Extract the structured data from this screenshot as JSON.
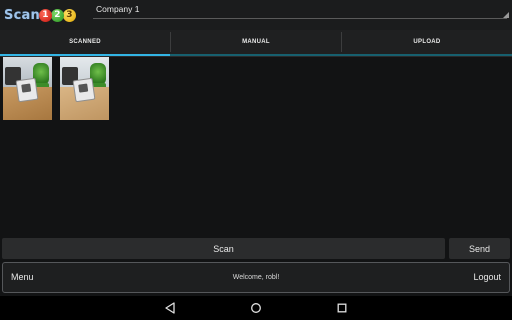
{
  "app": {
    "logo_text": "Scan",
    "logo_digits": [
      "1",
      "2",
      "3"
    ]
  },
  "company_select": {
    "value": "Company 1"
  },
  "tabs": [
    {
      "label": "SCANNED",
      "selected": true
    },
    {
      "label": "MANUAL",
      "selected": false
    },
    {
      "label": "UPLOAD",
      "selected": false
    }
  ],
  "thumbnails": [
    {
      "kind": "scanned-photo"
    },
    {
      "kind": "scanned-photo"
    }
  ],
  "actions": {
    "scan_label": "Scan",
    "send_label": "Send"
  },
  "footer": {
    "menu_label": "Menu",
    "welcome_text": "Welcome, robl!",
    "logout_label": "Logout"
  },
  "system_nav": {
    "icons": [
      "back-icon",
      "home-icon",
      "recent-apps-icon"
    ]
  },
  "colors": {
    "accent": "#33b5e5",
    "background": "#121314"
  }
}
